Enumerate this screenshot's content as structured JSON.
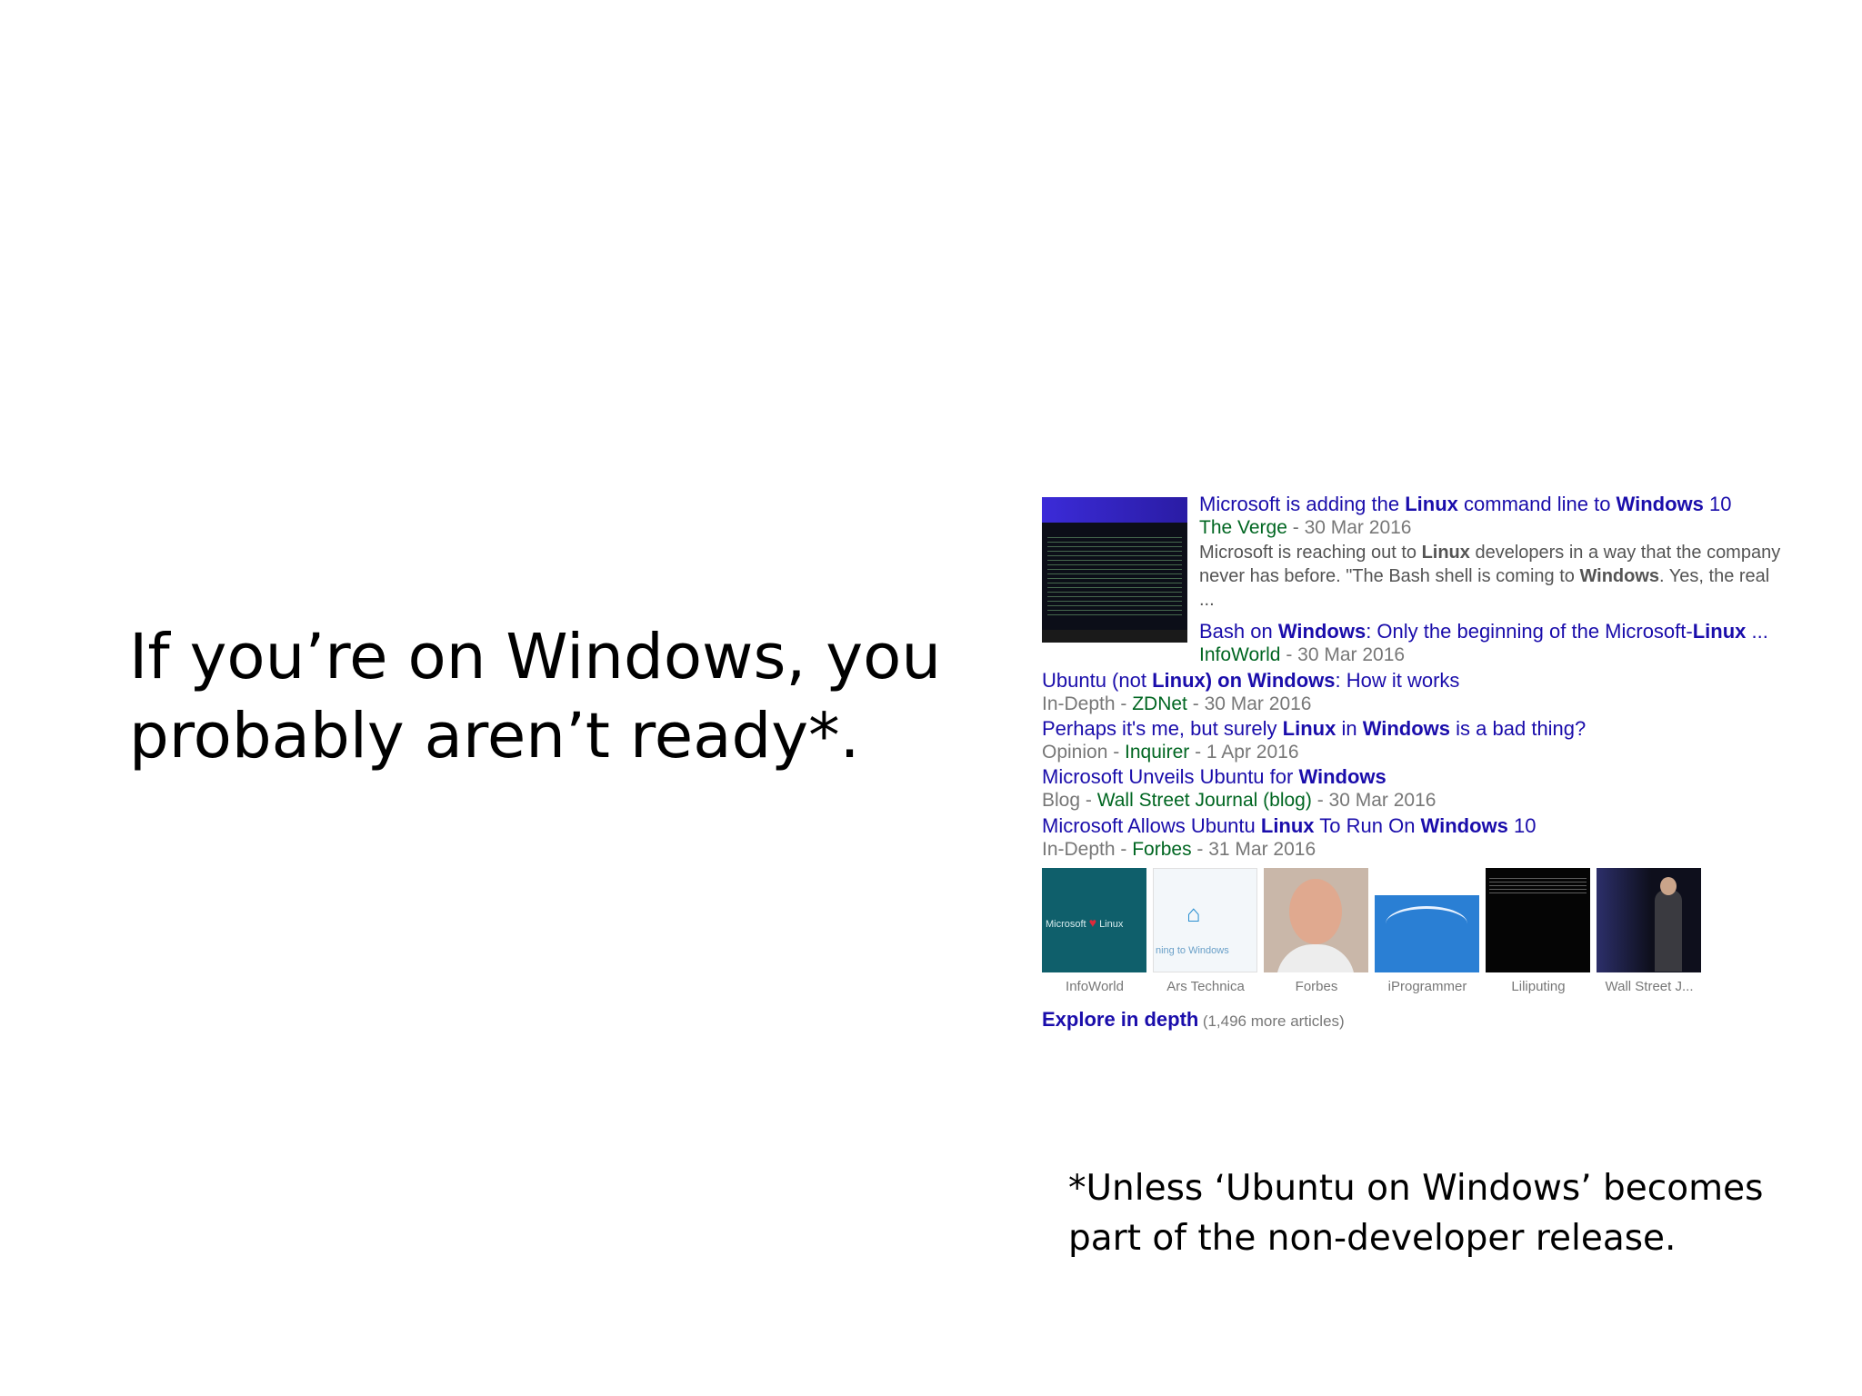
{
  "slide": {
    "title_line1": "If you’re on Windows, you",
    "title_line2": "probably aren’t ready*.",
    "footnote_line1": "*Unless ‘Ubuntu on Windows’ becomes",
    "footnote_line2": "part of the non-developer release."
  },
  "news": {
    "lead": {
      "headline_parts": [
        "Microsoft is adding the ",
        "Linux",
        " command line to ",
        "Windows",
        " 10"
      ],
      "source": "The Verge",
      "date": " - 30 Mar 2016",
      "snippet_parts": [
        "Microsoft is reaching out to ",
        "Linux",
        " developers in a way that the company never has before. \"The Bash shell is coming to ",
        "Windows",
        ". Yes, the real ..."
      ]
    },
    "sub": {
      "headline_parts": [
        "Bash on ",
        "Windows",
        ": Only the beginning of the Microsoft-",
        "Linux",
        " ..."
      ],
      "source": "InfoWorld",
      "date": " - 30 Mar 2016"
    },
    "items": [
      {
        "headline_parts": [
          "Ubuntu (not ",
          "Linux) on Windows",
          ": How it works"
        ],
        "prefix": "In-Depth - ",
        "source": "ZDNet",
        "date": " - 30 Mar 2016"
      },
      {
        "headline_parts": [
          "Perhaps it's me, but surely ",
          "Linux",
          " in ",
          "Windows",
          " is a bad thing?"
        ],
        "prefix": "Opinion - ",
        "source": "Inquirer",
        "date": " - 1 Apr 2016"
      },
      {
        "headline_parts": [
          "Microsoft Unveils Ubuntu for ",
          "Windows"
        ],
        "prefix": "Blog - ",
        "source": "Wall Street Journal (blog)",
        "date": " - 30 Mar 2016"
      },
      {
        "headline_parts": [
          "Microsoft Allows Ubuntu ",
          "Linux",
          " To Run On ",
          "Windows",
          " 10"
        ],
        "prefix": "In-Depth - ",
        "source": "Forbes",
        "date": " - 31 Mar 2016"
      }
    ],
    "thumbnails": [
      {
        "label": "InfoWorld",
        "caption_a": "Microsoft",
        "caption_b": "Linux"
      },
      {
        "label": "Ars Technica",
        "caption_a": "ning to Windows"
      },
      {
        "label": "Forbes"
      },
      {
        "label": "iProgrammer"
      },
      {
        "label": "Liliputing"
      },
      {
        "label": "Wall Street J..."
      }
    ],
    "explore": {
      "label": "Explore in depth",
      "count": "(1,496 more articles)"
    }
  }
}
